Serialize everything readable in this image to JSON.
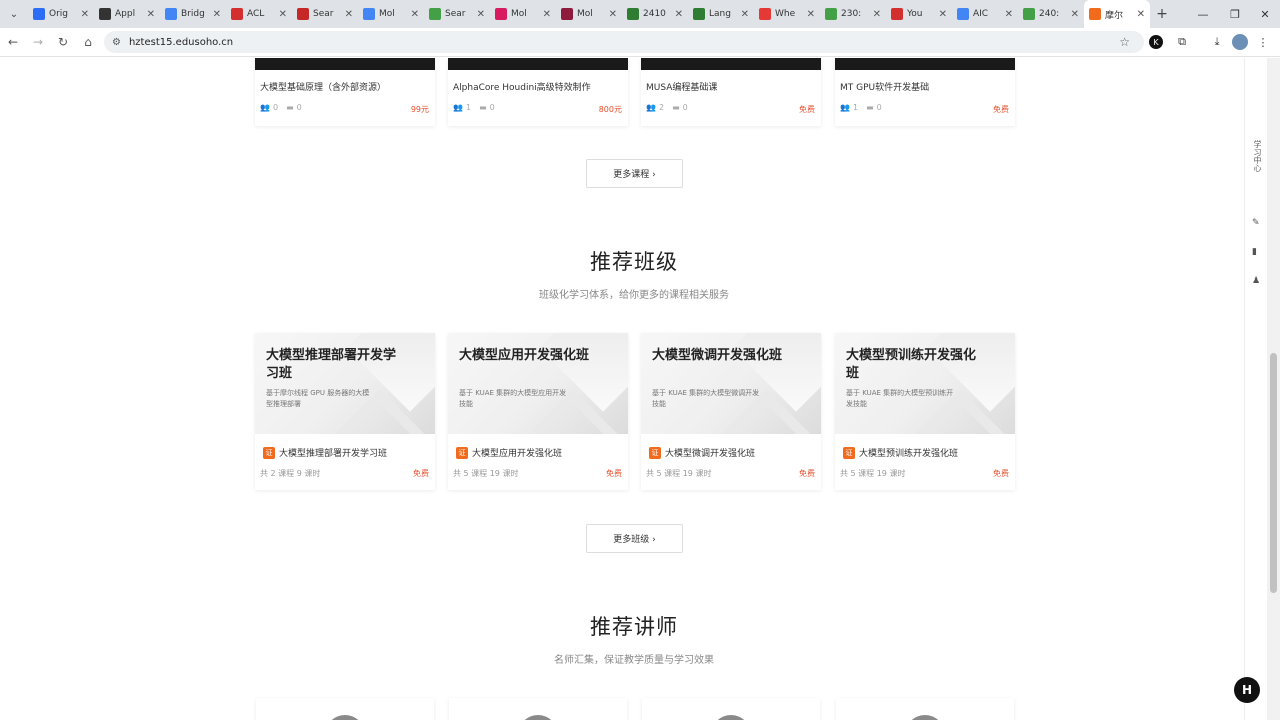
{
  "browser": {
    "tabs": [
      {
        "label": "Orig",
        "color": "#2d6df6"
      },
      {
        "label": "Appl",
        "color": "#333333"
      },
      {
        "label": "Bridg",
        "color": "#4285f4"
      },
      {
        "label": "ACL",
        "color": "#d32f2f"
      },
      {
        "label": "Sear",
        "color": "#c62828"
      },
      {
        "label": "Mol",
        "color": "#4285f4"
      },
      {
        "label": "Sear",
        "color": "#43a047"
      },
      {
        "label": "Mol",
        "color": "#d81b60"
      },
      {
        "label": "Mol",
        "color": "#8e1b3b"
      },
      {
        "label": "2410",
        "color": "#2e7d32"
      },
      {
        "label": "Lang",
        "color": "#2e7d32"
      },
      {
        "label": "Whe",
        "color": "#e53935"
      },
      {
        "label": "230:",
        "color": "#43a047"
      },
      {
        "label": "You",
        "color": "#d32f2f"
      },
      {
        "label": "AIC",
        "color": "#4285f4"
      },
      {
        "label": "240:",
        "color": "#43a047"
      },
      {
        "label": "摩尔",
        "color": "#f26b1d"
      }
    ],
    "url": "hztest15.edusoho.cn"
  },
  "courses": [
    {
      "title": "大模型基础原理（含外部资源）",
      "students": "0",
      "comments": "0",
      "price": "99元"
    },
    {
      "title": "AlphaCore Houdini高级特效制作",
      "students": "1",
      "comments": "0",
      "price": "800元"
    },
    {
      "title": "MUSA编程基础课",
      "students": "2",
      "comments": "0",
      "price": "免费"
    },
    {
      "title": "MT GPU软件开发基础",
      "students": "1",
      "comments": "0",
      "price": "免费"
    }
  ],
  "more_courses": "更多课程 ›",
  "classes_section": {
    "title": "推荐班级",
    "subtitle": "班级化学习体系，给你更多的课程相关服务",
    "items": [
      {
        "cover_title": "大模型推理部署开发学习班",
        "cover_desc": "基于摩尔线程 GPU 服务器的大模型推理部署",
        "name": "大模型推理部署开发学习班",
        "meta": "共 2 课程 9 课时",
        "price": "免费"
      },
      {
        "cover_title": "大模型应用开发强化班",
        "cover_desc": "基于 KUAE 集群的大模型应用开发技能",
        "name": "大模型应用开发强化班",
        "meta": "共 5 课程 19 课时",
        "price": "免费"
      },
      {
        "cover_title": "大模型微调开发强化班",
        "cover_desc": "基于 KUAE 集群的大模型微调开发技能",
        "name": "大模型微调开发强化班",
        "meta": "共 5 课程 19 课时",
        "price": "免费"
      },
      {
        "cover_title": "大模型预训练开发强化班",
        "cover_desc": "基于 KUAE 集群的大模型预训练开发技能",
        "name": "大模型预训练开发强化班",
        "meta": "共 5 课程 19 课时",
        "price": "免费"
      }
    ],
    "badge": "证",
    "more": "更多班级 ›"
  },
  "teachers_section": {
    "title": "推荐讲师",
    "subtitle": "名师汇集，保证教学质量与学习效果"
  },
  "rail": {
    "text": "学习中心"
  },
  "float_button": "H"
}
